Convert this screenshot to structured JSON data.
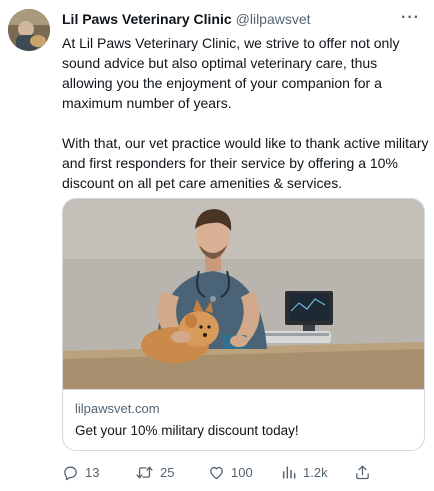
{
  "tweet": {
    "author_name": "Lil Paws Veterinary Clinic",
    "author_handle": "@lilpawsvet",
    "more_label": "···",
    "paragraph_1": "At Lil Paws Veterinary Clinic, we strive to offer not only sound advice but also optimal veterinary care, thus allowing you the enjoyment of your companion for a maximum number of years.",
    "paragraph_2": "With that, our vet practice would like to thank active military and first responders for their service by offering a 10% discount on all pet care amenities & services."
  },
  "card": {
    "domain": "lilpawsvet.com",
    "title": "Get your 10% military discount today!"
  },
  "actions": {
    "replies": "13",
    "reposts": "25",
    "likes": "100",
    "views": "1.2k"
  },
  "icons": {
    "reply": "reply-icon",
    "repost": "repost-icon",
    "like": "heart-icon",
    "views": "views-icon",
    "share": "share-icon"
  },
  "colors": {
    "text": "#0f1419",
    "secondary": "#536471",
    "border": "#cfd9de"
  }
}
